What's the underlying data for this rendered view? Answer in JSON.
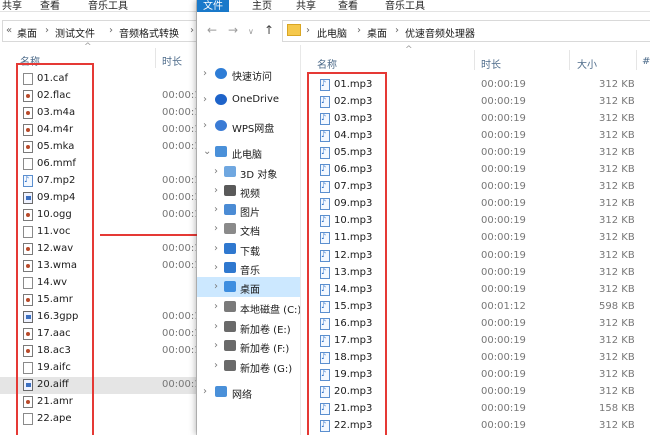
{
  "left_window": {
    "ribbon": {
      "tab1": "共享",
      "tab2": "查看",
      "tab3": "音乐工具"
    },
    "breadcrumb": [
      "桌面",
      "测试文件",
      "音频格式转换"
    ],
    "columns": {
      "name": "名称",
      "duration": "时长"
    },
    "files": [
      {
        "name": "01.caf",
        "duration": "",
        "icon": "blank"
      },
      {
        "name": "02.flac",
        "duration": "00:00:1",
        "icon": "media"
      },
      {
        "name": "03.m4a",
        "duration": "00:00:1",
        "icon": "media"
      },
      {
        "name": "04.m4r",
        "duration": "00:00:1",
        "icon": "media"
      },
      {
        "name": "05.mka",
        "duration": "00:00:1",
        "icon": "media"
      },
      {
        "name": "06.mmf",
        "duration": "",
        "icon": "blank"
      },
      {
        "name": "07.mp2",
        "duration": "00:00:1",
        "icon": "mp3"
      },
      {
        "name": "09.mp4",
        "duration": "00:00:1",
        "icon": "vid"
      },
      {
        "name": "10.ogg",
        "duration": "00:00:1",
        "icon": "media"
      },
      {
        "name": "11.voc",
        "duration": "",
        "icon": "blank"
      },
      {
        "name": "12.wav",
        "duration": "00:00:1",
        "icon": "media"
      },
      {
        "name": "13.wma",
        "duration": "00:00:1",
        "icon": "media"
      },
      {
        "name": "14.wv",
        "duration": "",
        "icon": "blank"
      },
      {
        "name": "15.amr",
        "duration": "",
        "icon": "media"
      },
      {
        "name": "16.3gpp",
        "duration": "00:00:1",
        "icon": "vid"
      },
      {
        "name": "17.aac",
        "duration": "00:00:1",
        "icon": "media"
      },
      {
        "name": "18.ac3",
        "duration": "00:00:1",
        "icon": "media"
      },
      {
        "name": "19.aifc",
        "duration": "",
        "icon": "blank"
      },
      {
        "name": "20.aiff",
        "duration": "00:00:1",
        "icon": "vid"
      },
      {
        "name": "21.amr",
        "duration": "",
        "icon": "media"
      },
      {
        "name": "22.ape",
        "duration": "",
        "icon": "blank"
      }
    ]
  },
  "right_window": {
    "ribbon": {
      "tab1": "文件",
      "tab2": "主页",
      "tab3": "共享",
      "tab4": "查看",
      "tab5": "音乐工具"
    },
    "breadcrumb": [
      "此电脑",
      "桌面",
      "优速音频处理器"
    ],
    "columns": {
      "name": "名称",
      "duration": "时长",
      "size": "大小",
      "extra": "#"
    },
    "nav": [
      {
        "label": "快速访问",
        "icon": "star-icon",
        "indent": 0
      },
      {
        "label": "OneDrive",
        "icon": "cloud-icon",
        "indent": 0
      },
      {
        "label": "WPS网盘",
        "icon": "wps-cloud-icon",
        "indent": 0
      },
      {
        "label": "此电脑",
        "icon": "computer-icon",
        "indent": 0
      },
      {
        "label": "3D 对象",
        "icon": "3d-objects-icon",
        "indent": 1
      },
      {
        "label": "视频",
        "icon": "video-folder-icon",
        "indent": 1
      },
      {
        "label": "图片",
        "icon": "pictures-folder-icon",
        "indent": 1
      },
      {
        "label": "文档",
        "icon": "documents-folder-icon",
        "indent": 1
      },
      {
        "label": "下载",
        "icon": "download-folder-icon",
        "indent": 1
      },
      {
        "label": "音乐",
        "icon": "music-folder-icon",
        "indent": 1
      },
      {
        "label": "桌面",
        "icon": "desktop-folder-icon",
        "indent": 1
      },
      {
        "label": "本地磁盘 (C:)",
        "icon": "drive-c-icon",
        "indent": 1
      },
      {
        "label": "新加卷 (E:)",
        "icon": "drive-icon",
        "indent": 1
      },
      {
        "label": "新加卷 (F:)",
        "icon": "drive-icon",
        "indent": 1
      },
      {
        "label": "新加卷 (G:)",
        "icon": "drive-icon",
        "indent": 1
      },
      {
        "label": "网络",
        "icon": "network-icon",
        "indent": 0
      }
    ],
    "files": [
      {
        "name": "01.mp3",
        "duration": "00:00:19",
        "size": "312 KB"
      },
      {
        "name": "02.mp3",
        "duration": "00:00:19",
        "size": "312 KB"
      },
      {
        "name": "03.mp3",
        "duration": "00:00:19",
        "size": "312 KB"
      },
      {
        "name": "04.mp3",
        "duration": "00:00:19",
        "size": "312 KB"
      },
      {
        "name": "05.mp3",
        "duration": "00:00:19",
        "size": "312 KB"
      },
      {
        "name": "06.mp3",
        "duration": "00:00:19",
        "size": "312 KB"
      },
      {
        "name": "07.mp3",
        "duration": "00:00:19",
        "size": "312 KB"
      },
      {
        "name": "09.mp3",
        "duration": "00:00:19",
        "size": "312 KB"
      },
      {
        "name": "10.mp3",
        "duration": "00:00:19",
        "size": "312 KB"
      },
      {
        "name": "11.mp3",
        "duration": "00:00:19",
        "size": "312 KB"
      },
      {
        "name": "12.mp3",
        "duration": "00:00:19",
        "size": "312 KB"
      },
      {
        "name": "13.mp3",
        "duration": "00:00:19",
        "size": "312 KB"
      },
      {
        "name": "14.mp3",
        "duration": "00:00:19",
        "size": "312 KB"
      },
      {
        "name": "15.mp3",
        "duration": "00:01:12",
        "size": "598 KB"
      },
      {
        "name": "16.mp3",
        "duration": "00:00:19",
        "size": "312 KB"
      },
      {
        "name": "17.mp3",
        "duration": "00:00:19",
        "size": "312 KB"
      },
      {
        "name": "18.mp3",
        "duration": "00:00:19",
        "size": "312 KB"
      },
      {
        "name": "19.mp3",
        "duration": "00:00:19",
        "size": "312 KB"
      },
      {
        "name": "20.mp3",
        "duration": "00:00:19",
        "size": "312 KB"
      },
      {
        "name": "21.mp3",
        "duration": "00:00:19",
        "size": "158 KB"
      },
      {
        "name": "22.mp3",
        "duration": "00:00:19",
        "size": "312 KB"
      }
    ]
  },
  "colors": {
    "annotation": "#e53935",
    "accent": "#1979ca",
    "selection": "#cde8ff"
  }
}
